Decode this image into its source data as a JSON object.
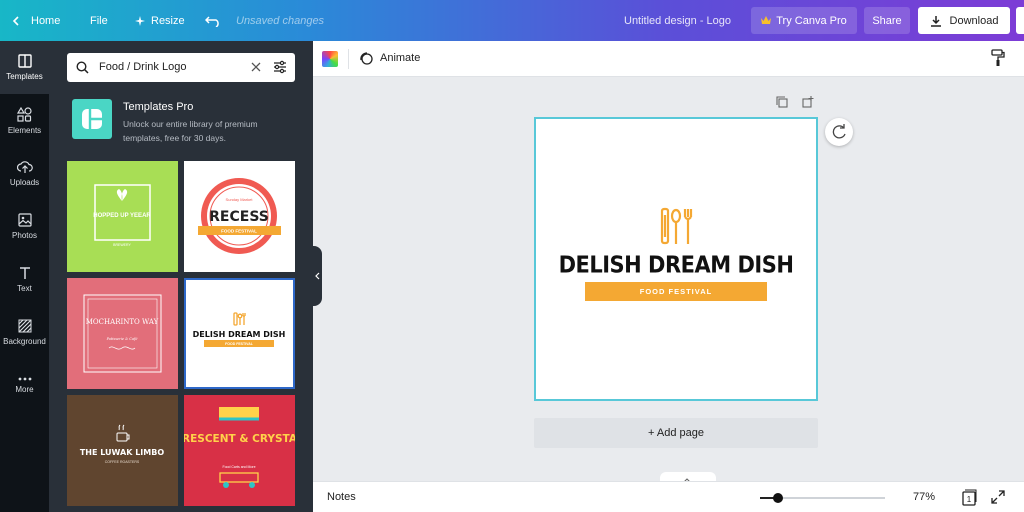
{
  "topbar": {
    "home": "Home",
    "file": "File",
    "resize": "Resize",
    "unsaved": "Unsaved changes",
    "title": "Untitled design - Logo",
    "try_pro": "Try Canva Pro",
    "share": "Share",
    "download": "Download"
  },
  "rail": {
    "items": [
      {
        "label": "Templates",
        "icon": "templates-icon"
      },
      {
        "label": "Elements",
        "icon": "elements-icon"
      },
      {
        "label": "Uploads",
        "icon": "uploads-icon"
      },
      {
        "label": "Photos",
        "icon": "photos-icon"
      },
      {
        "label": "Text",
        "icon": "text-icon"
      },
      {
        "label": "Background",
        "icon": "background-icon"
      },
      {
        "label": "More",
        "icon": "more-icon"
      }
    ]
  },
  "panel": {
    "search_value": "Food / Drink Logo",
    "promo_title": "Templates Pro",
    "promo_desc": "Unlock our entire library of premium templates, free for 30 days.",
    "templates": [
      {
        "title": "HOPPED UP YEEAR",
        "sub": "BREWERY"
      },
      {
        "title": "RECESS",
        "top": "Sunday Market",
        "band": "FOOD FESTIVAL"
      },
      {
        "title": "MOCHARINTO WAY",
        "sub": "Patisserie & Café"
      },
      {
        "title": "DELISH DREAM DISH",
        "band": "FOOD FESTIVAL"
      },
      {
        "title": "THE LUWAK LIMBO",
        "sub": "COFFEE ROASTERS"
      },
      {
        "title": "CRESCENT & CRYSTAL",
        "sub": "Food Carts and More"
      }
    ]
  },
  "toolbar": {
    "animate": "Animate"
  },
  "canvas": {
    "logo_title": "DELISH DREAM DISH",
    "logo_band": "FOOD FESTIVAL",
    "add_page": "+ Add page"
  },
  "bottom": {
    "notes": "Notes",
    "zoom": "77%",
    "zoom_level": 0.14,
    "page_count": "1"
  },
  "colors": {
    "accent_teal": "#58c8d8",
    "orange": "#f4a833",
    "sidebar_dark": "#0e1318",
    "panel": "#293039"
  }
}
